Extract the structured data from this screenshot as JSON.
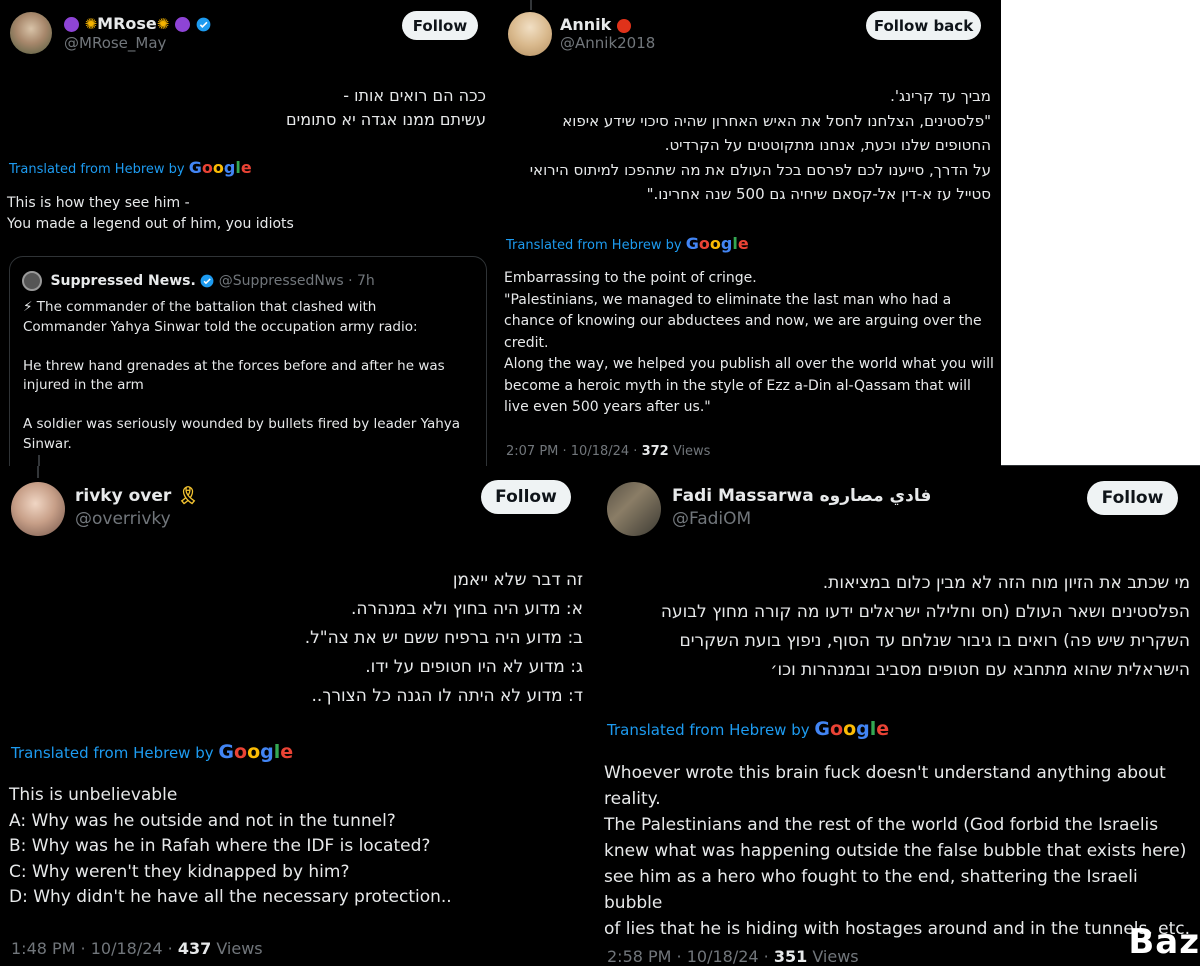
{
  "translation": {
    "prefix": "Translated from Hebrew by",
    "brand": "Google",
    "brand_colors": [
      "#4285f4",
      "#ea4335",
      "#fbbc05",
      "#4285f4",
      "#34a853",
      "#ea4335"
    ]
  },
  "tweets": [
    {
      "display_name": "MRose",
      "handle": "@MRose_May",
      "follow_label": "Follow",
      "hebrew_lines": [
        "ככה הם רואים אותו -",
        "עשיתם ממנו אגדה יא סתומים"
      ],
      "english_lines": [
        "This is how they see him -",
        "You made a legend out of him, you idiots"
      ],
      "quote": {
        "name": "Suppressed News.",
        "handle_time": "@SuppressedNws · 7h",
        "lines": [
          "⚡ The commander of the battalion that clashed with",
          "Commander Yahya Sinwar told the occupation army radio:",
          "",
          "He threw hand grenades at the forces before and after he was",
          "injured in the arm",
          "",
          "A soldier was seriously wounded by bullets fired by leader Yahya",
          "Sinwar."
        ]
      }
    },
    {
      "display_name": "Annik",
      "name_emoji": "🍅",
      "handle": "@Annik2018",
      "follow_label": "Follow back",
      "hebrew_lines": [
        "מביך עד קרינג'.",
        "\"פלסטינים, הצלחנו לחסל את האיש האחרון שהיה סיכוי שידע איפוא",
        "החטופים שלנו וכעת, אנחנו מתקוטטים על הקרדיט.",
        "על הדרך, סייענו לכם לפרסם בכל העולם את מה שתהפכו למיתוס הירואי",
        "סטייל עז א-דין אל-קסאם שיחיה גם 500 שנה אחרינו.\""
      ],
      "english_lines": [
        "Embarrassing to the point of cringe.",
        "\"Palestinians, we managed to eliminate the last man who had a",
        "chance of knowing our abductees and now, we are arguing over the",
        "credit.",
        "Along the way, we helped you publish all over the world what you will",
        "become a heroic myth in the style of Ezz a-Din al-Qassam that will",
        "live even 500 years after us.\""
      ],
      "timestamp": "2:07 PM · 10/18/24 · ",
      "views_count": "372",
      "views_label": " Views"
    },
    {
      "display_name": "rivky over",
      "name_emoji": "🎗️",
      "handle": "@overrivky",
      "follow_label": "Follow",
      "hebrew_lines": [
        "זה דבר שלא ייאמן",
        "א: מדוע היה בחוץ ולא במנהרה.",
        "ב: מדוע היה ברפיח ששם יש את צה\"ל.",
        "ג: מדוע לא היו חטופים על ידו.",
        "ד: מדוע לא היתה לו הגנה כל הצורך.."
      ],
      "english_lines": [
        "This is unbelievable",
        "A: Why was he outside and not in the tunnel?",
        "B: Why was he in Rafah where the IDF is located?",
        "C: Why weren't they kidnapped by him?",
        "D: Why didn't he have all the necessary protection.."
      ],
      "timestamp": "1:48 PM · 10/18/24 · ",
      "views_count": "437",
      "views_label": " Views"
    },
    {
      "display_name": "Fadi Massarwa فادي مصاروه",
      "handle": "@FadiOM",
      "follow_label": "Follow",
      "hebrew_lines": [
        "מי שכתב את הזיון מוח הזה לא מבין כלום במציאות.",
        "הפלסטינים ושאר העולם (חס וחלילה ישראלים ידעו מה קורה מחוץ לבועה",
        "השקרית שיש פה) רואים בו גיבור שנלחם עד הסוף, ניפוץ בועת השקרים",
        "הישראלית שהוא מתחבא עם חטופים מסביב ובמנהרות וכו׳"
      ],
      "english_lines": [
        "Whoever wrote this brain fuck doesn't understand anything about",
        "reality.",
        "The Palestinians and the rest of the world (God forbid the Israelis",
        "knew what was happening outside the false bubble that exists here)",
        "see him as a hero who fought to the end, shattering the Israeli bubble",
        "of lies that he is hiding with hostages around and in the tunnels, etc."
      ],
      "timestamp": "2:58 PM · 10/18/24 · ",
      "views_count": "351",
      "views_label": " Views"
    }
  ],
  "watermark": "Baz"
}
